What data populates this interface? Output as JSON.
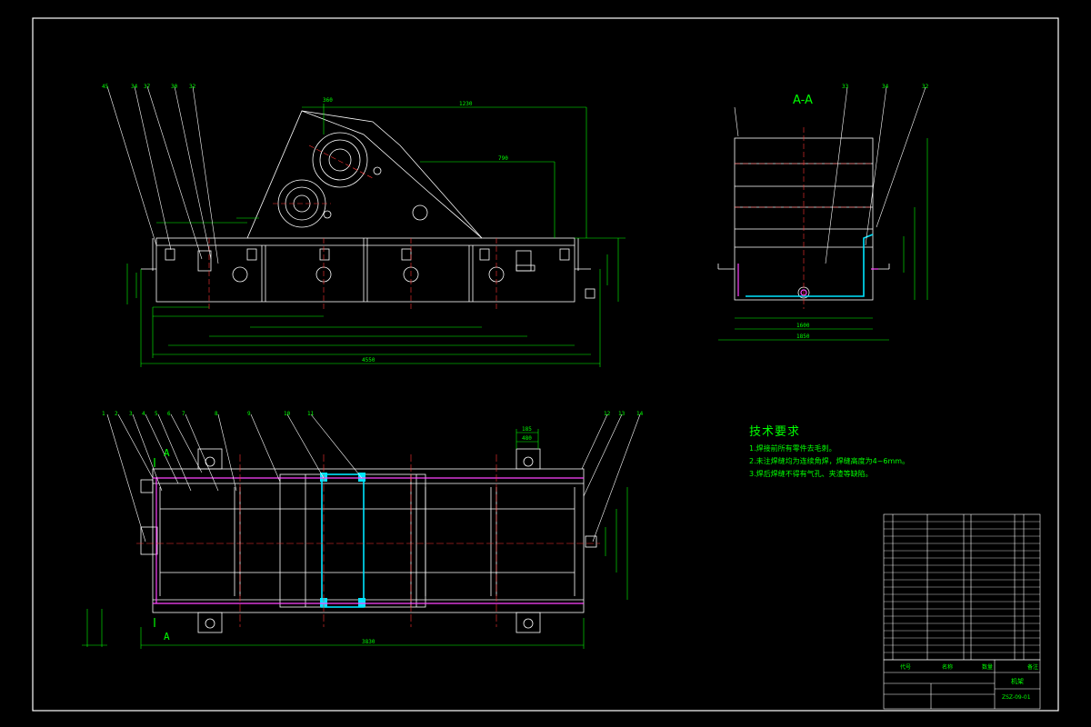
{
  "colors": {
    "background": "#000000",
    "frame": "#ffffff",
    "geometry": "#ffffff",
    "dimension": "#00ff00",
    "centerline": "#ff3333",
    "weld": "#ff44ff",
    "cyan": "#00e5ff"
  },
  "section_view": {
    "title": "A-A"
  },
  "technical_requirements": {
    "title": "技术要求",
    "items": [
      "1.焊接前所有零件去毛刺。",
      "2.未注焊缝均为连续角焊，焊缝高度为4~6mm。",
      "3.焊后焊缝不得有气孔、夹渣等缺陷。"
    ]
  },
  "dimensions": {
    "top_span": "1230",
    "mid_span": "790",
    "base_left": "360",
    "overall_length": "4550",
    "bottom_length": "3830",
    "section_width": "1850",
    "section_inner": "1600",
    "plan_side": "185",
    "plan_dim2": "480"
  },
  "section_marker": "A",
  "title_block": {
    "drawing_name": "机架",
    "drawing_number": "ZSZ-09-01",
    "col_code": "代号",
    "col_name": "名称",
    "col_qty": "数量",
    "col_note": "备注"
  }
}
